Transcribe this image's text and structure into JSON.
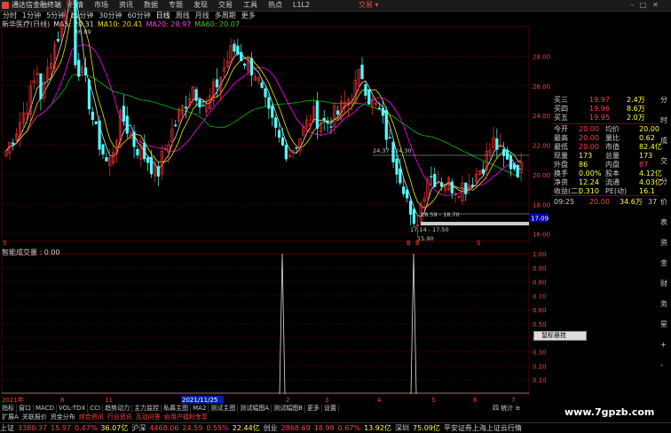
{
  "titlebar": {
    "app_title": "通达信金融终端",
    "menu": [
      "行情",
      "市场",
      "资讯",
      "数据",
      "专题",
      "发现",
      "交易",
      "工具",
      "热点",
      "L1L2"
    ],
    "trade_label": "交易 ▾"
  },
  "periodbar": {
    "items": [
      "分时",
      "1分钟",
      "5分钟",
      "15分钟",
      "30分钟",
      "60分钟",
      "日线",
      "周线",
      "月线",
      "多周期",
      "更多"
    ]
  },
  "maline": {
    "stock": "新华医疗(日线)",
    "ma5": "MA5: 20.31",
    "ma10": "MA10: 20.41",
    "ma20": "MA20: 20.97",
    "ma60": "MA60: 20.07"
  },
  "indicator_label": "智能成交量 : 0.00",
  "colors": {
    "up": "#ff3232",
    "down": "#54ffff",
    "ma5": "#e0e0e0",
    "ma10": "#e6e600",
    "ma20": "#ff00ff",
    "ma60": "#00c000",
    "grid": "#7a0000"
  },
  "chart_data": {
    "type": "candlestick",
    "y_ticks": [
      "28.00",
      "26.00",
      "24.00",
      "22.00",
      "20.00",
      "18.00",
      "16.00"
    ],
    "y_range": [
      15.5,
      30.0
    ],
    "annotations": [
      "36.89",
      "24.37 - 24.30",
      "18.59 - 18.70",
      "17.14 - 17.50",
      "15.90"
    ],
    "current_price": "17.09",
    "indicator_ticks": [
      "1.00",
      "0.90",
      "0.80",
      "0.70",
      "0.60",
      "0.50",
      "0.40",
      "0.30",
      "0.20",
      "0.10"
    ],
    "indicator_spikes": [
      {
        "x": "2021/11/25",
        "value": 1.0
      },
      {
        "x": "5月",
        "value": 1.0
      }
    ],
    "x_labels": [
      "2021年",
      "8",
      "11",
      "2021/11/25",
      "2",
      "3",
      "4",
      "5",
      "6",
      "7"
    ],
    "markers": [
      "S",
      "B",
      "B",
      "S"
    ]
  },
  "quote": {
    "rows": [
      {
        "label": "买三",
        "price": "19.97",
        "vol": "2.4万"
      },
      {
        "label": "买四",
        "price": "19.96",
        "vol": "8.6万"
      },
      {
        "label": "买五",
        "price": "19.95",
        "vol": "2.0万"
      },
      {
        "label": "今开",
        "price": "20.00",
        "label2": "均价",
        "val2": "20.00"
      },
      {
        "label": "最高",
        "price": "20.00",
        "label2": "量比",
        "val2": "0.62"
      },
      {
        "label": "最低",
        "price": "20.00",
        "label2": "市值",
        "val2": "82.4亿"
      },
      {
        "label": "现量",
        "price": "173",
        "label2": "总量",
        "val2": "173"
      },
      {
        "label": "外盘",
        "price": "86",
        "label2": "内盘",
        "val2": "87"
      },
      {
        "label": "换手",
        "price": "0.00%",
        "label2": "股本",
        "val2": "4.12亿"
      },
      {
        "label": "净资",
        "price": "12.24",
        "label2": "流通",
        "val2": "4.03亿"
      },
      {
        "label": "收益(二)",
        "price": "0.310",
        "label2": "PE(动)",
        "val2": "16.1"
      }
    ],
    "last_trade": {
      "time": "09:25",
      "price": "20.00",
      "vol": "34.6万",
      "n": "37"
    }
  },
  "rsidebar": [
    "分",
    "时",
    "成",
    "交",
    "分",
    "价",
    "表",
    "资",
    "金",
    "财",
    "务",
    "星",
    "+",
    "-"
  ],
  "bottom": {
    "tabs1": [
      "指标",
      "窗口",
      "MACD",
      "VOL-TDX",
      "CCI",
      "趋势动力",
      "主力监控",
      "私募主图",
      "MA2",
      "测试主图",
      "测试幅图A",
      "测试幅图B",
      "更多",
      "设置"
    ],
    "tabs2": [
      "扩展A",
      "关联报价",
      "资金分布",
      "综合资讯",
      "行业资讯",
      "互动问答",
      "俞用户福利专享"
    ],
    "tooltip": "鼠标悬挂",
    "status": [
      {
        "t": "上证",
        "c": "#ccc"
      },
      {
        "t": "3380.37",
        "c": "#ff4040"
      },
      {
        "t": "15.97",
        "c": "#ff4040"
      },
      {
        "t": "0.47%",
        "c": "#ff4040"
      },
      {
        "t": "36.07亿",
        "c": "#ffff40"
      },
      {
        "t": "沪深",
        "c": "#ccc"
      },
      {
        "t": "4468.06",
        "c": "#ff4040"
      },
      {
        "t": "24.59",
        "c": "#ff4040"
      },
      {
        "t": "0.55%",
        "c": "#ff4040"
      },
      {
        "t": "22.44亿",
        "c": "#ffff40"
      },
      {
        "t": "创业",
        "c": "#ccc"
      },
      {
        "t": "2868.69",
        "c": "#ff4040"
      },
      {
        "t": "18.98",
        "c": "#ff4040"
      },
      {
        "t": "0.67%",
        "c": "#ff4040"
      },
      {
        "t": "13.92亿",
        "c": "#ffff40"
      },
      {
        "t": "深圳",
        "c": "#ccc"
      },
      {
        "t": "75.09亿",
        "c": "#ffff40"
      },
      {
        "t": "平安证券上海上证云行情",
        "c": "#ccc"
      }
    ],
    "watermark": "www.7gpzb.com",
    "corner": "四 统计 ≡"
  }
}
